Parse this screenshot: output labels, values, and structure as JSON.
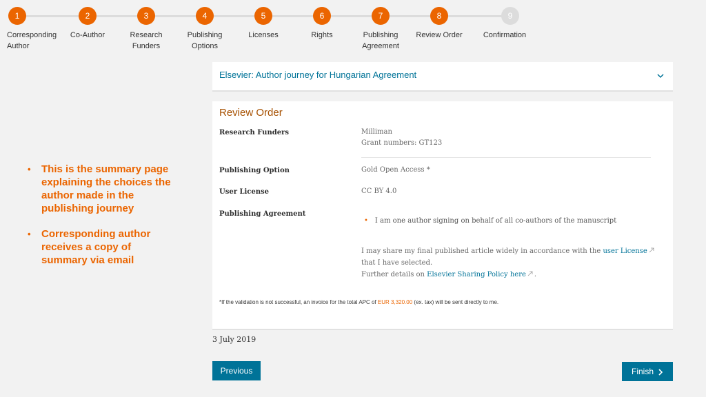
{
  "stepper": {
    "steps": [
      {
        "number": "1",
        "label": "Corresponding Author"
      },
      {
        "number": "2",
        "label": "Co-Author"
      },
      {
        "number": "3",
        "label": "Research Funders"
      },
      {
        "number": "4",
        "label": "Publishing Options"
      },
      {
        "number": "5",
        "label": "Licenses"
      },
      {
        "number": "6",
        "label": "Rights"
      },
      {
        "number": "7",
        "label": "Publishing Agreement"
      },
      {
        "number": "8",
        "label": "Review Order"
      },
      {
        "number": "9",
        "label": "Confirmation"
      }
    ],
    "active_color": "#eb6500",
    "inactive_color": "#dcdcdc"
  },
  "notes": [
    "This is the summary page explaining the choices the author made in the publishing journey",
    "Corresponding author receives a copy of summary via email"
  ],
  "journey": {
    "title": "Elsevier: Author journey for Hungarian Agreement",
    "icon": "chevron-down-icon"
  },
  "review": {
    "title": "Review Order",
    "research_funders_label": "Research Funders",
    "research_funders_value": "Milliman",
    "grant_numbers": "Grant numbers: GT123",
    "publishing_option_label": "Publishing Option",
    "publishing_option_value": "Gold Open Access *",
    "user_license_label": "User License",
    "user_license_value": "CC BY 4.0",
    "publishing_agreement_label": "Publishing Agreement",
    "agreement_bullet": "I am one author signing on behalf of all co-authors of the manuscript",
    "share_text_1": "I may share my final published article widely in accordance with the",
    "share_link_1": "user License",
    "share_text_2": "that I have selected.",
    "share_text_3": "Further details on",
    "share_link_2": "Elsevier Sharing Policy here",
    "share_text_4": ".",
    "footnote_pre": "*If the validation is not successful, an invoice for the total APC of",
    "footnote_amount": "EUR 3,320.00",
    "footnote_post": "(ex. tax) will be sent directly to me."
  },
  "date": "3 July 2019",
  "buttons": {
    "previous": "Previous",
    "finish": "Finish"
  },
  "colors": {
    "accent": "#eb6500",
    "link": "#007398",
    "title": "#a65000"
  }
}
